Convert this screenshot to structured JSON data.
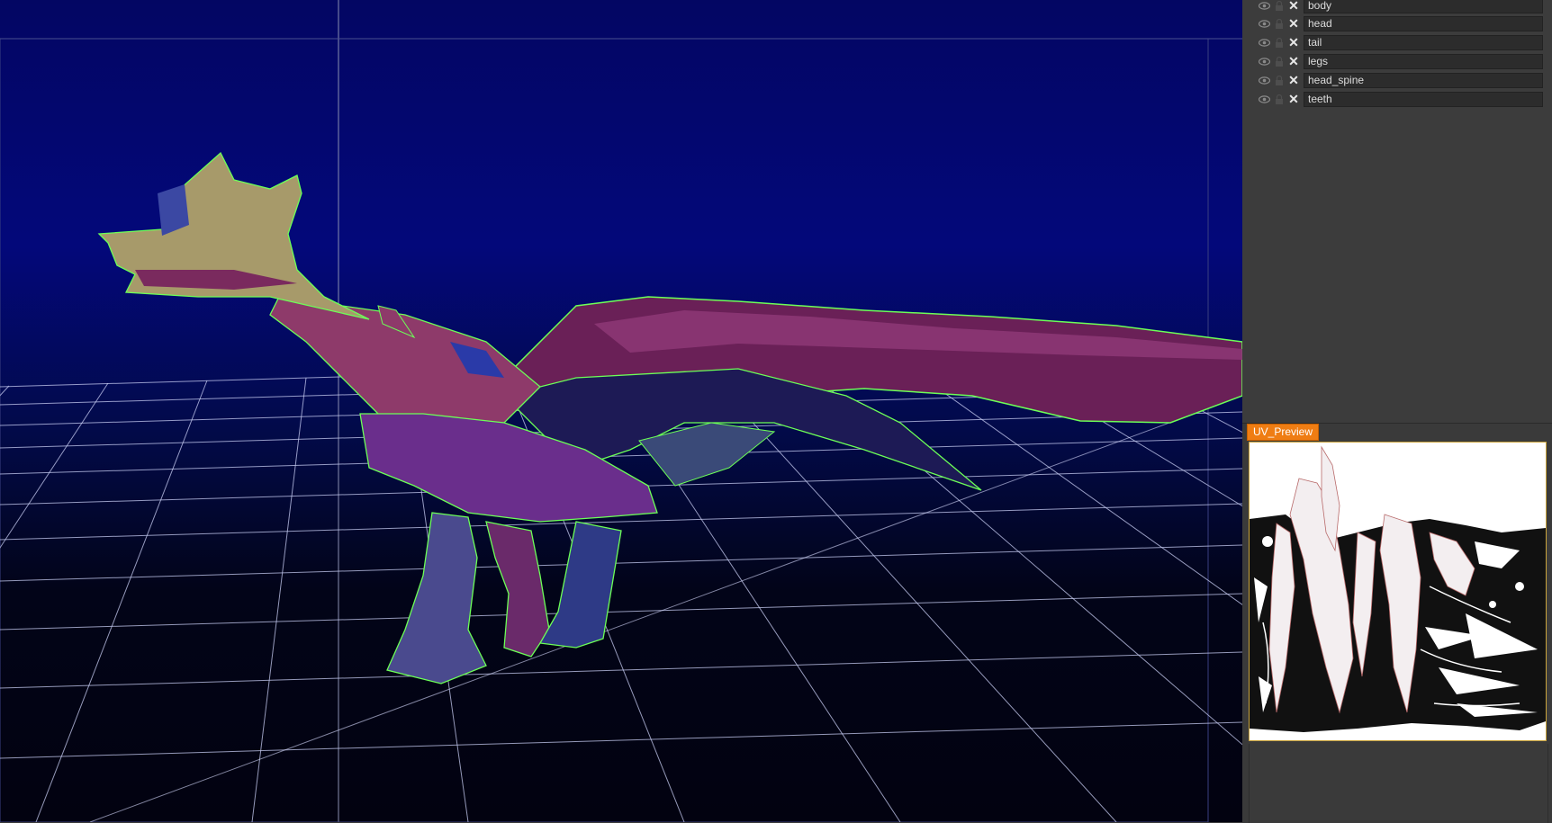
{
  "viewport": {
    "background_top": "#03087a",
    "background_bottom": "#020210",
    "grid_color": "#c9d0ff",
    "wireframe_color": "#6cff57",
    "model_colors": [
      "#7a2a63",
      "#9b4a8c",
      "#a89a68",
      "#3a3a8e",
      "#5c2e7a"
    ]
  },
  "layers": {
    "items": [
      {
        "label": "body"
      },
      {
        "label": "head"
      },
      {
        "label": "tail"
      },
      {
        "label": "legs"
      },
      {
        "label": "head_spine"
      },
      {
        "label": "teeth"
      }
    ],
    "icons": {
      "visibility": "eye-icon",
      "lock": "lock-icon",
      "delete": "close-icon"
    }
  },
  "uv_preview": {
    "tab_label": "UV_Preview",
    "accent": "#ef7d13",
    "frame_color": "#c8a23a"
  }
}
